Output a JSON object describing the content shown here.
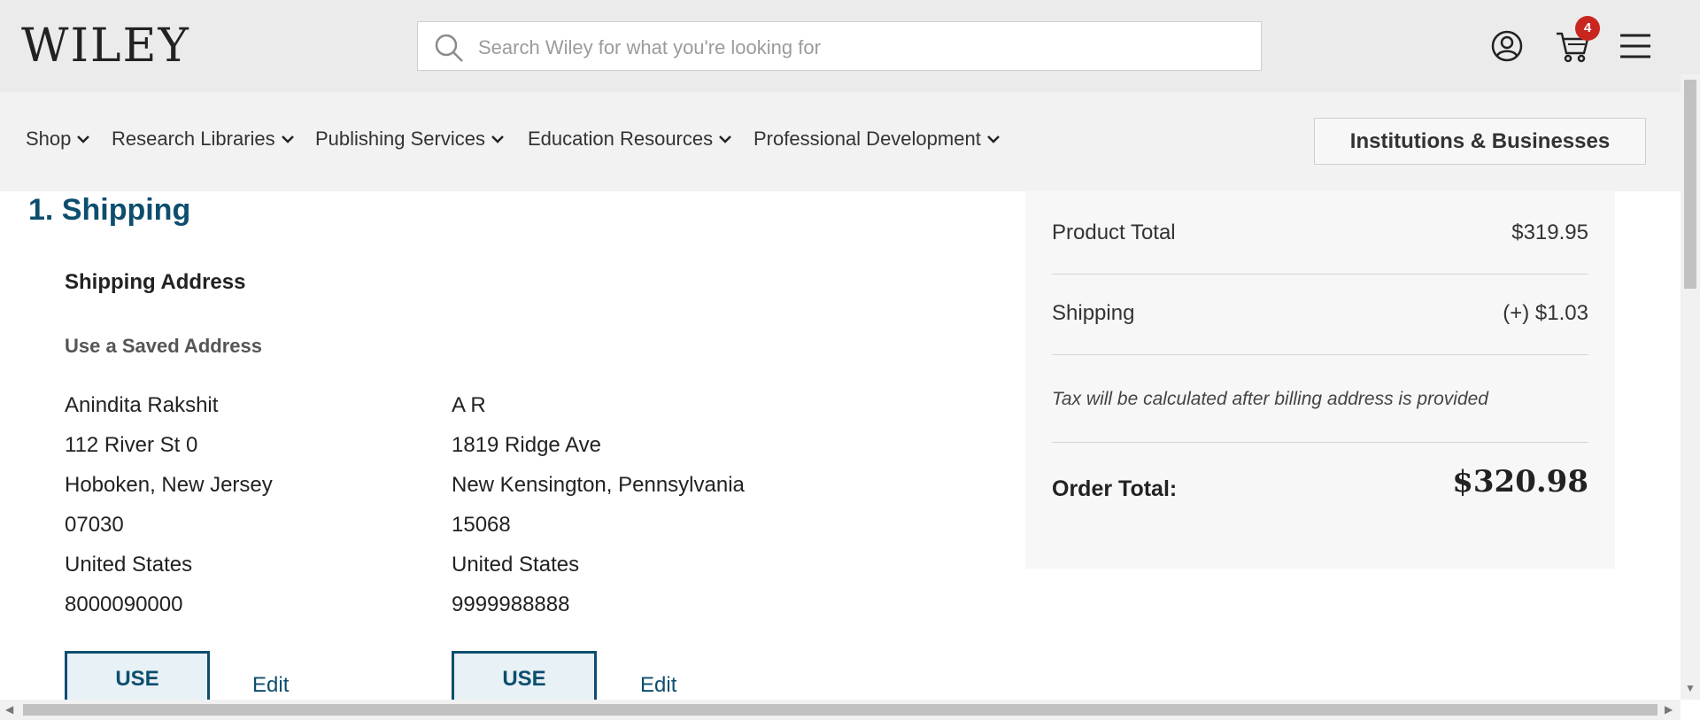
{
  "header": {
    "logo": "WILEY",
    "search_placeholder": "Search Wiley for what you're looking for",
    "cart_count": "4"
  },
  "nav": {
    "items": [
      {
        "label": "Shop"
      },
      {
        "label": "Research Libraries"
      },
      {
        "label": "Publishing Services"
      },
      {
        "label": "Education Resources"
      },
      {
        "label": "Professional Development"
      }
    ],
    "institutions_button": "Institutions & Businesses"
  },
  "shipping": {
    "step_title": "1. Shipping",
    "heading": "Shipping Address",
    "saved_label": "Use a Saved Address",
    "addresses": [
      {
        "name": "Anindita Rakshit",
        "street": "112 River St 0",
        "city_state": "Hoboken, New Jersey",
        "zip": "07030",
        "country": "United States",
        "phone": "8000090000",
        "use_label": "USE",
        "edit_label": "Edit"
      },
      {
        "name": "A R",
        "street": "1819 Ridge Ave",
        "city_state": "New Kensington, Pennsylvania",
        "zip": "15068",
        "country": "United States",
        "phone": "9999988888",
        "use_label": "USE",
        "edit_label": "Edit"
      }
    ]
  },
  "summary": {
    "product_total_label": "Product Total",
    "product_total_value": "$319.95",
    "shipping_label": "Shipping",
    "shipping_value": "(+) $1.03",
    "tax_note": "Tax will be calculated after billing address is provided",
    "order_total_label": "Order Total:",
    "order_total_value": "$320.98"
  },
  "colors": {
    "brand_blue": "#0d4e6e",
    "badge_red": "#c9261f"
  }
}
